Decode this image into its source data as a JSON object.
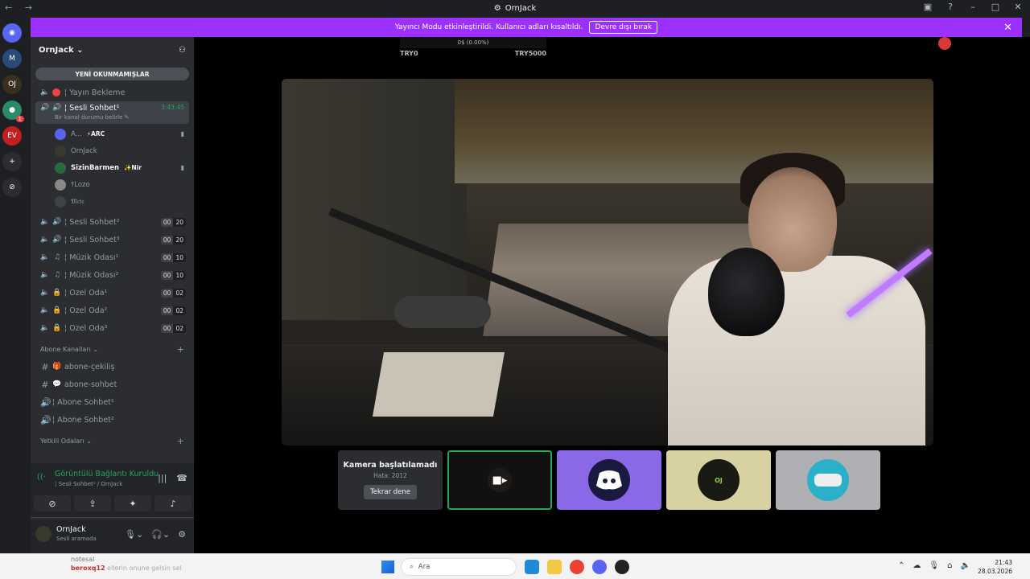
{
  "window": {
    "title": "OrnJack",
    "nav": "← →"
  },
  "banner": {
    "text": "Yayıncı Modu etkinleştirildi. Kullanıcı adları kısaltıldı.",
    "button": "Devre dışı bırak",
    "close": "✕"
  },
  "guilds": [
    {
      "name": "discord-home",
      "label": "◉",
      "color": "#5865f2"
    },
    {
      "name": "guild-m",
      "label": "M",
      "color": "#2a4a7a"
    },
    {
      "name": "guild-ornjack",
      "label": "OJ",
      "color": "#3a3020"
    },
    {
      "name": "guild-green",
      "label": "●",
      "color": "#2a8a6a",
      "badge": "1"
    },
    {
      "name": "guild-ev",
      "label": "EV",
      "color": "#c02020"
    },
    {
      "name": "add-server",
      "label": "+",
      "color": "#2b2d31"
    },
    {
      "name": "explore",
      "label": "⊘",
      "color": "#2b2d31"
    }
  ],
  "server": {
    "name": "OrnJack",
    "unread_pill": "YENİ OKUNMAMIŞLAR"
  },
  "channels_top": [
    {
      "name": "¦ Yayın Bekleme",
      "type": "stage"
    }
  ],
  "active_channel": {
    "name": "¦ Sesli Sohbet¹",
    "time": "3:43:45",
    "status": "Bir kanal durumu belirle ✎"
  },
  "voice_users": [
    {
      "name": "A...",
      "tag": "⚡ARC",
      "cam": true,
      "bold": false,
      "color": "#5865f2"
    },
    {
      "name": "OrnJack",
      "tag": "",
      "cam": false,
      "bold": false,
      "color": "#3a3a2a"
    },
    {
      "name": "SizinBarmen",
      "tag": "✨Nir",
      "cam": true,
      "bold": true,
      "color": "#2a6a3a"
    },
    {
      "name": "†Lozo",
      "tag": "",
      "cam": false,
      "bold": false,
      "color": "#888888"
    },
    {
      "name": "𝔐𝔢𝔱𝔢",
      "tag": "",
      "cam": false,
      "bold": false,
      "color": "#404249"
    }
  ],
  "channels": [
    {
      "name": "¦ Sesli Sohbet²",
      "icon": "🔊",
      "a": "00",
      "b": "20"
    },
    {
      "name": "¦ Sesli Sohbet³",
      "icon": "🔊",
      "a": "00",
      "b": "20"
    },
    {
      "name": "¦ Müzik Odası¹",
      "icon": "♫",
      "a": "00",
      "b": "10"
    },
    {
      "name": "¦ Müzik Odası²",
      "icon": "♫",
      "a": "00",
      "b": "10"
    },
    {
      "name": "¦ Özel Oda¹",
      "icon": "🔒",
      "a": "00",
      "b": "02"
    },
    {
      "name": "¦ Özel Oda²",
      "icon": "🔒",
      "a": "00",
      "b": "02"
    },
    {
      "name": "¦ Özel Oda³",
      "icon": "🔒",
      "a": "00",
      "b": "02"
    }
  ],
  "category_subs": "Abone Kanalları",
  "sub_channels": [
    {
      "name": "abone-çekiliş",
      "icon": "#",
      "prefix": "🎁"
    },
    {
      "name": "abone-sohbet",
      "icon": "#",
      "prefix": "💬"
    },
    {
      "name": "¦ Abone Sohbet¹",
      "icon": "🔊",
      "prefix": ""
    },
    {
      "name": "¦ Abone Sohbet²",
      "icon": "🔊",
      "prefix": ""
    }
  ],
  "category_auth": "Yetkili Odaları",
  "voice_panel": {
    "connected": "Görüntülü Bağlantı Kuruldu",
    "sub": "¦ Sesli Sohbet¹ / OrnJack"
  },
  "user_panel": {
    "name": "OrnJack",
    "status": "Sesli aramada"
  },
  "mini": {
    "progress": "0$ (0.00%)",
    "left": "TRY0",
    "right": "TRY5000"
  },
  "error_tile": {
    "title": "Kamera başlatılamadı",
    "code": "Hata: 2012",
    "retry": "Tekrar dene"
  },
  "taskbar": {
    "note1": "notesal",
    "note2_user": "beroxq12",
    "note2_text": "  ellerin onune gelsin sel",
    "search": "Ara",
    "time": "21:43",
    "date": "28.03.2026"
  }
}
